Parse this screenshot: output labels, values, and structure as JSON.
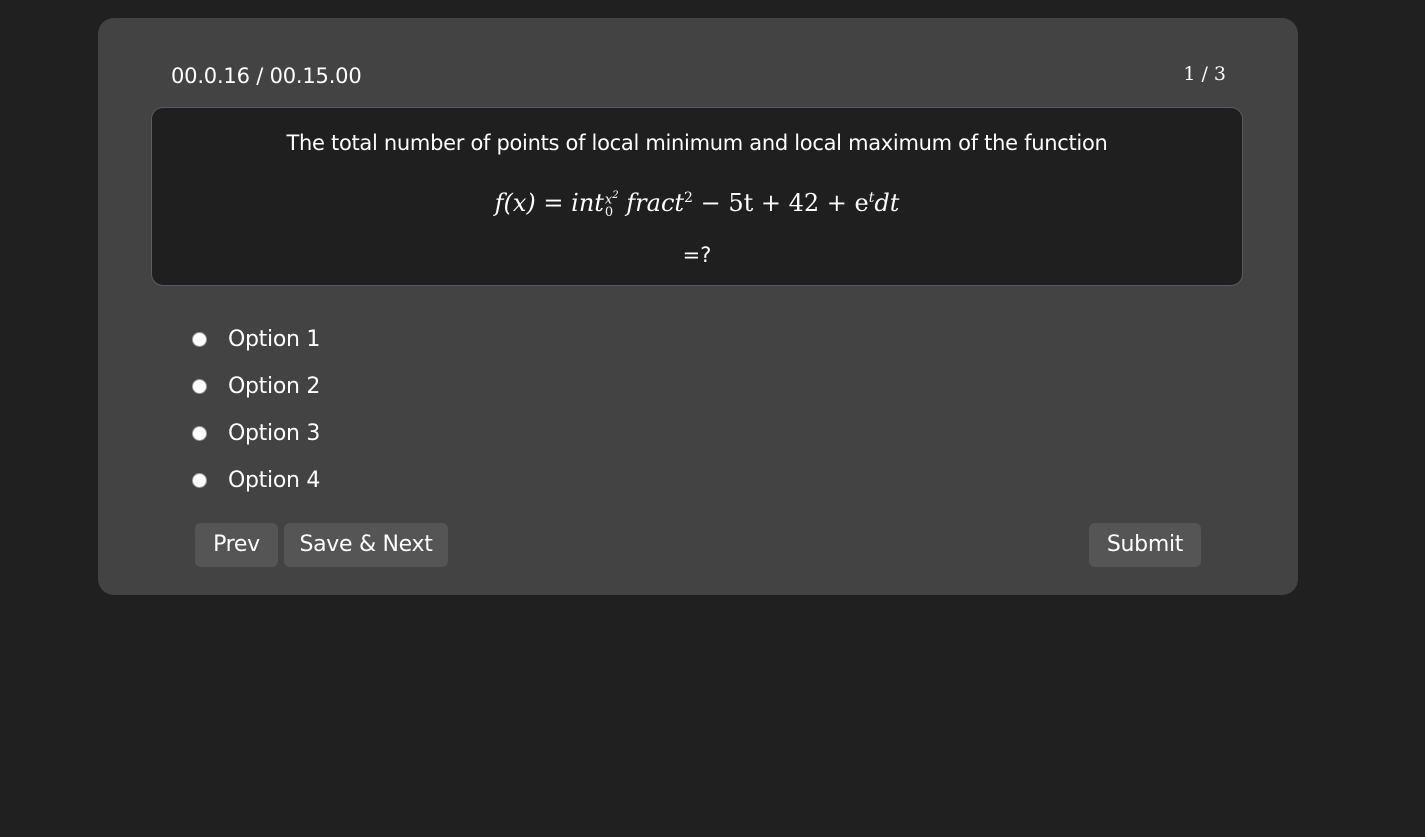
{
  "quiz": {
    "timer": "00.0.16 / 00.15.00",
    "counter": "1 / 3",
    "question": {
      "text": "The total number of points of local minimum and local maximum of the function",
      "formula_parts": {
        "lhs": "f(x) = int",
        "sup": "x",
        "sup_exp": "2",
        "sub": "0",
        "mid": "fract",
        "mid_exp": "2",
        "rest": " − 5t + 42 + e",
        "e_exp": "t",
        "tail": "dt"
      },
      "suffix": "=?"
    },
    "options": [
      {
        "label": "Option 1",
        "checked": false
      },
      {
        "label": "Option 2",
        "checked": false
      },
      {
        "label": "Option 3",
        "checked": false
      },
      {
        "label": "Option 4",
        "checked": false
      }
    ],
    "buttons": {
      "prev": "Prev",
      "save_next": "Save & Next",
      "submit": "Submit"
    }
  }
}
